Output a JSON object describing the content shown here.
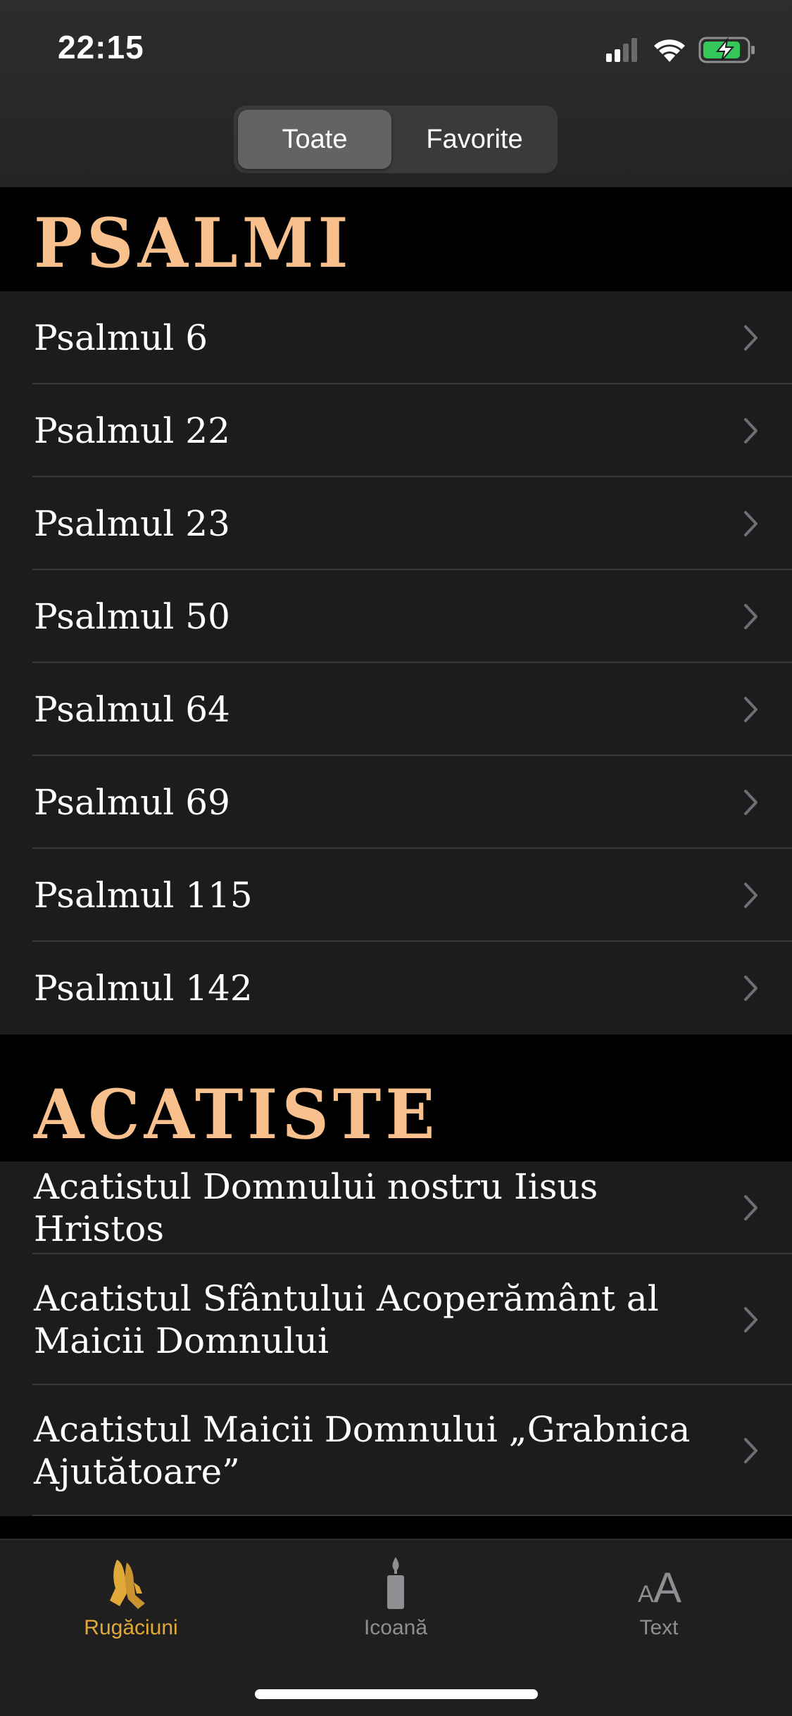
{
  "status_bar": {
    "time": "22:15"
  },
  "segmented": {
    "options": [
      "Toate",
      "Favorite"
    ],
    "selected": "Toate"
  },
  "sections": [
    {
      "title": "PSALMI",
      "items": [
        "Psalmul 6",
        "Psalmul 22",
        "Psalmul 23",
        "Psalmul 50",
        "Psalmul 64",
        "Psalmul 69",
        "Psalmul 115",
        "Psalmul 142"
      ]
    },
    {
      "title": "ACATISTE",
      "items": [
        "Acatistul Domnului nostru Iisus Hristos",
        "Acatistul Sfântului Acoperământ al Maicii Domnului",
        "Acatistul Maicii Domnului „Grabnica Ajutătoare”"
      ]
    }
  ],
  "tabbar": {
    "tabs": [
      {
        "label": "Rugăciuni",
        "icon": "praying-hands-icon",
        "active": true
      },
      {
        "label": "Icoană",
        "icon": "candle-icon",
        "active": false
      },
      {
        "label": "Text",
        "icon": "text-size-icon",
        "active": false
      }
    ]
  },
  "colors": {
    "accent": "#e0a93a",
    "section_title": "#f7c08c",
    "inactive_tab": "#8e8e93",
    "row_bg": "#1c1c1e"
  }
}
